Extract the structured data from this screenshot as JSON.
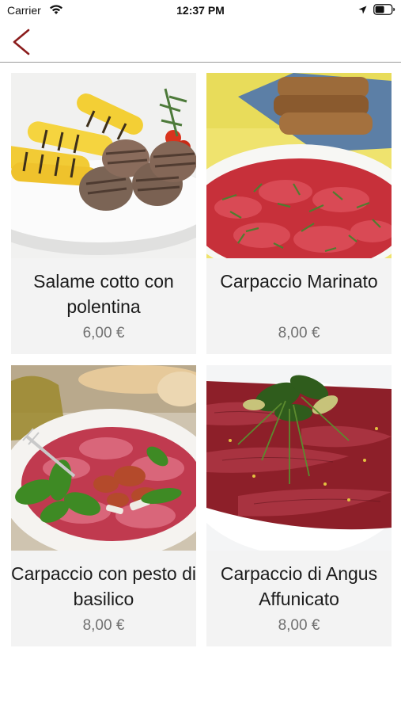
{
  "status_bar": {
    "carrier": "Carrier",
    "time": "12:37 PM",
    "icons": [
      "wifi-icon",
      "location-icon",
      "battery-icon"
    ]
  },
  "nav": {
    "back_icon": "chevron-left-icon",
    "accent_color": "#8b1c1c"
  },
  "products": [
    {
      "title": "Salame cotto con polentina",
      "price": "6,00 €",
      "image": "grilled-sausage-polenta-photo"
    },
    {
      "title": "Carpaccio Marinato",
      "price": "8,00 €",
      "image": "marinated-carpaccio-photo"
    },
    {
      "title": "Carpaccio con pesto di basilico",
      "price": "8,00 €",
      "image": "carpaccio-basil-pesto-photo"
    },
    {
      "title": "Carpaccio di Angus Affunicato",
      "price": "8,00 €",
      "image": "smoked-angus-carpaccio-photo"
    }
  ],
  "colors": {
    "card_background": "#f3f3f3",
    "price_text": "#707070",
    "divider": "#9a9a9a"
  }
}
